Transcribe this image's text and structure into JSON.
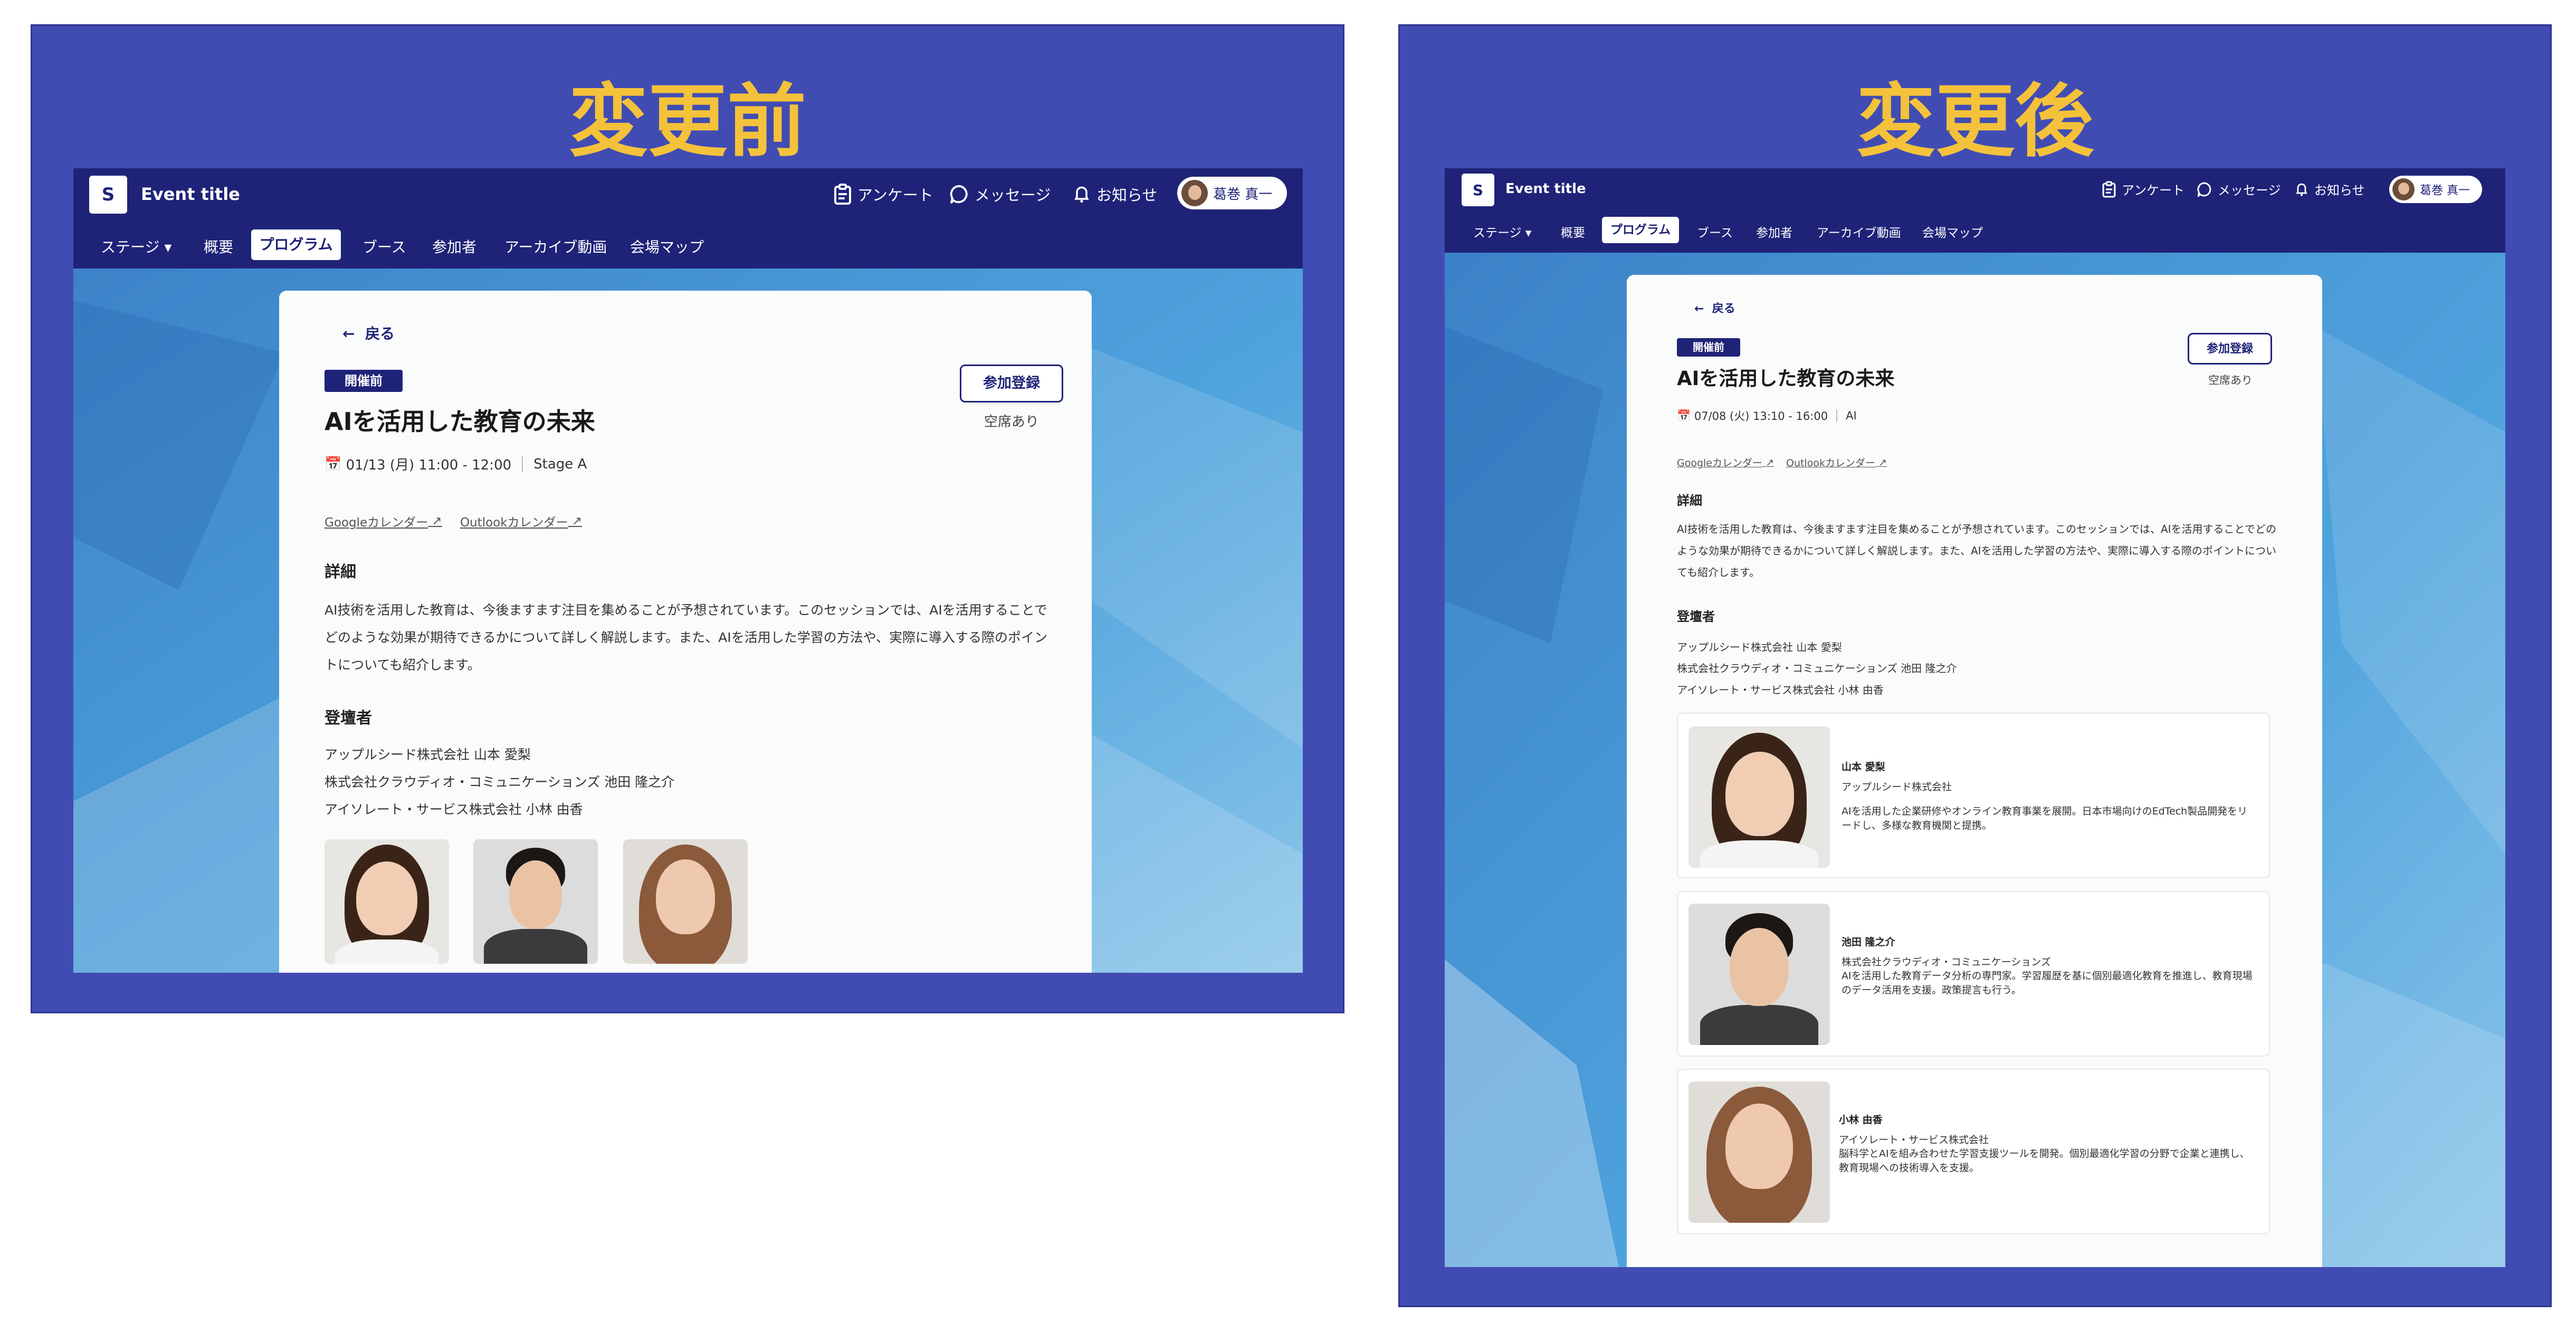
{
  "colors": {
    "frame": "#414cb3",
    "header": "#1f2378",
    "heading_accent": "#f4c23a",
    "card": "#fafbfb"
  },
  "before": {
    "heading": "変更前",
    "header": {
      "app_title": "Event title",
      "survey": "アンケート",
      "messages": "メッセージ",
      "notifications": "お知らせ",
      "user_name": "葛巻 真一"
    },
    "nav": [
      "ステージ",
      "概要",
      "プログラム",
      "ブース",
      "参加者",
      "アーカイブ動画",
      "会場マップ"
    ],
    "nav_active": "プログラム",
    "detail": {
      "back": "戻る",
      "badge": "開催前",
      "title": "AIを活用した教育の未来",
      "register_button": "参加登録",
      "vacancy": "空席あり",
      "datetime": "01/13 (月) 11:00 - 12:00",
      "venue": "Stage A",
      "google_calendar": "Googleカレンダー",
      "outlook_calendar": "Outlookカレンダー",
      "details_heading": "詳細",
      "details_text": "AI技術を活用した教育は、今後ますます注目を集めることが予想されています。このセッションでは、AIを活用することでどのような効果が期待できるかについて詳しく解説します。また、AIを活用した学習の方法や、実際に導入する際のポイントについても紹介します。",
      "registrants_heading": "登壇者",
      "registrants": [
        "アップルシード株式会社 山本 愛梨",
        "株式会社クラウディオ・コミュニケーションズ 池田 隆之介",
        "アイソレート・サービス株式会社 小林 由香"
      ]
    }
  },
  "after": {
    "heading": "変更後",
    "header": {
      "app_title": "Event title",
      "survey": "アンケート",
      "messages": "メッセージ",
      "notifications": "お知らせ",
      "user_name": "葛巻 真一"
    },
    "nav": [
      "ステージ",
      "概要",
      "プログラム",
      "ブース",
      "参加者",
      "アーカイブ動画",
      "会場マップ"
    ],
    "nav_active": "プログラム",
    "detail": {
      "back": "戻る",
      "badge": "開催前",
      "title": "AIを活用した教育の未来",
      "register_button": "参加登録",
      "vacancy": "空席あり",
      "datetime": "07/08 (火) 13:10 - 16:00",
      "venue": "AI",
      "google_calendar": "Googleカレンダー",
      "outlook_calendar": "Outlookカレンダー",
      "details_heading": "詳細",
      "details_text": "AI技術を活用した教育は、今後ますます注目を集めることが予想されています。このセッションでは、AIを活用することでどのような効果が期待できるかについて詳しく解説します。また、AIを活用した学習の方法や、実際に導入する際のポイントについても紹介します。",
      "registrants_heading": "登壇者",
      "registrants": [
        "アップルシード株式会社 山本 愛梨",
        "株式会社クラウディオ・コミュニケーションズ 池田 隆之介",
        "アイソレート・サービス株式会社 小林 由香"
      ],
      "speakers": [
        {
          "name": "山本 愛梨",
          "company": "アップルシード株式会社",
          "description": "AIを活用した企業研修やオンライン教育事業を展開。日本市場向けのEdTech製品開発をリードし、多様な教育機関と提携。"
        },
        {
          "name": "池田 隆之介",
          "company": "株式会社クラウディオ・コミュニケーションズ",
          "description": "AIを活用した教育データ分析の専門家。学習履歴を基に個別最適化教育を推進し、教育現場のデータ活用を支援。政策提言も行う。"
        },
        {
          "name": "小林 由香",
          "company": "アイソレート・サービス株式会社",
          "description": "脳科学とAIを組み合わせた学習支援ツールを開発。個別最適化学習の分野で企業と連携し、教育現場への技術導入を支援。"
        }
      ]
    }
  }
}
